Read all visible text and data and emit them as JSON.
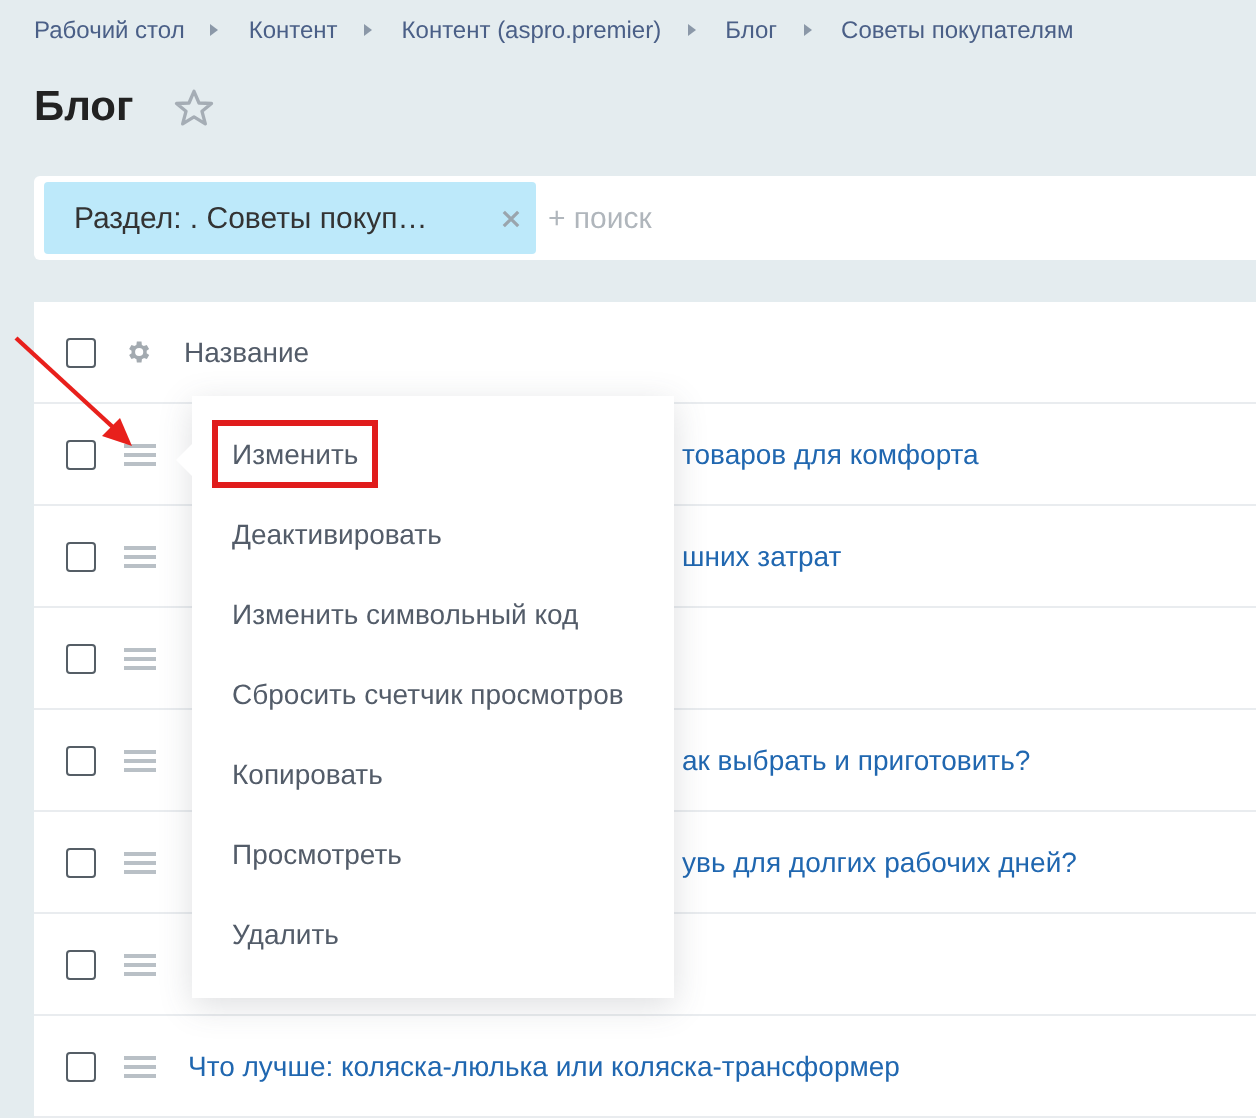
{
  "breadcrumbs": [
    "Рабочий стол",
    "Контент",
    "Контент (aspro.premier)",
    "Блог",
    "Советы покупателям"
  ],
  "title": "Блог",
  "favorite": false,
  "filter": {
    "tag": "Раздел: . Советы покуп…",
    "placeholder": "+ поиск"
  },
  "table": {
    "header_checked": false,
    "columns": [
      "Название"
    ],
    "rows": [
      {
        "checked": false,
        "title": "товаров для комфорта"
      },
      {
        "checked": false,
        "title": "шних затрат"
      },
      {
        "checked": false
      },
      {
        "checked": false,
        "title": "ак выбрать и приготовить?"
      },
      {
        "checked": false,
        "title": "увь для долгих рабочих дней?"
      },
      {
        "checked": false
      },
      {
        "checked": false,
        "title": "Что лучше: коляска-люлька или коляска-трансформер"
      }
    ]
  },
  "context_menu": {
    "items": [
      {
        "label": "Изменить",
        "outlined": true
      },
      {
        "label": "Деактивировать",
        "outlined": false
      },
      {
        "label": "Изменить символьный код",
        "outlined": false
      },
      {
        "label": "Сбросить счетчик просмотров",
        "outlined": false
      },
      {
        "label": "Копировать",
        "outlined": false
      },
      {
        "label": "Просмотреть",
        "outlined": false
      },
      {
        "label": "Удалить",
        "outlined": false
      }
    ]
  }
}
